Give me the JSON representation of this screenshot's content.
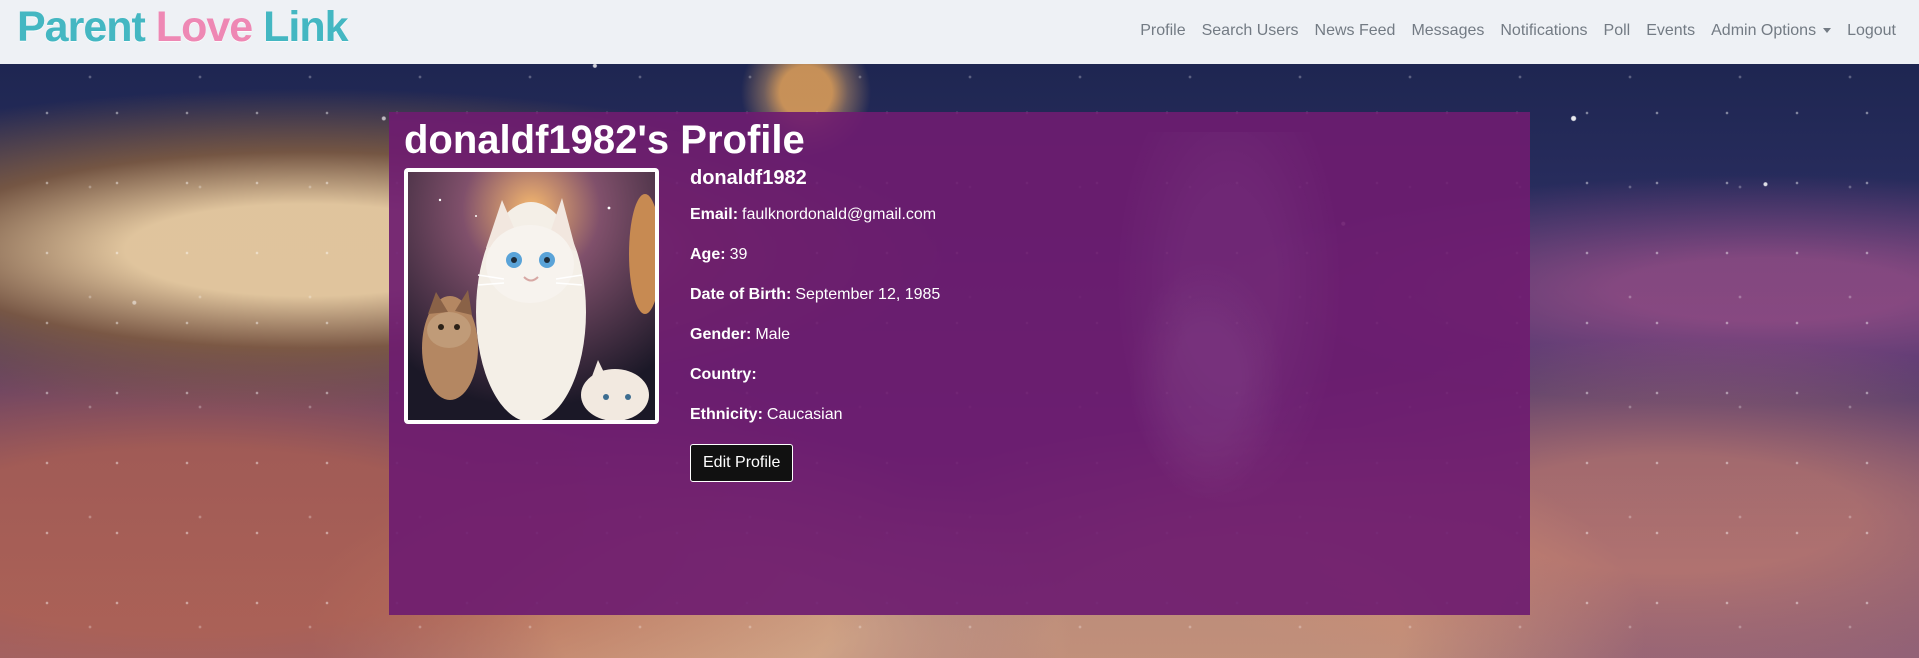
{
  "brand": {
    "part1": "Parent",
    "part2": "Love",
    "part3": "Link"
  },
  "nav": {
    "items": [
      {
        "label": "Profile"
      },
      {
        "label": "Search Users"
      },
      {
        "label": "News Feed"
      },
      {
        "label": "Messages"
      },
      {
        "label": "Notifications"
      },
      {
        "label": "Poll"
      },
      {
        "label": "Events"
      },
      {
        "label": "Admin Options",
        "dropdown_icon": "chevron-down-icon"
      },
      {
        "label": "Logout"
      }
    ]
  },
  "profile": {
    "title": "donaldf1982's Profile",
    "username": "donaldf1982",
    "avatar_icon": "profile-photo",
    "fields": [
      {
        "label": "Email:",
        "value": "faulknordonald@gmail.com"
      },
      {
        "label": "Age:",
        "value": "39"
      },
      {
        "label": "Date of Birth:",
        "value": "September 12, 1985"
      },
      {
        "label": "Gender:",
        "value": "Male"
      },
      {
        "label": "Country:",
        "value": ""
      },
      {
        "label": "Ethnicity:",
        "value": "Caucasian"
      }
    ],
    "edit_button": "Edit Profile"
  },
  "colors": {
    "navbar_background": "#eef1f5",
    "brand_teal": "#44b7c2",
    "brand_pink": "#ee88b4",
    "panel_purple": "#6e1c70",
    "button_black": "#111111",
    "text_white": "#ffffff"
  }
}
